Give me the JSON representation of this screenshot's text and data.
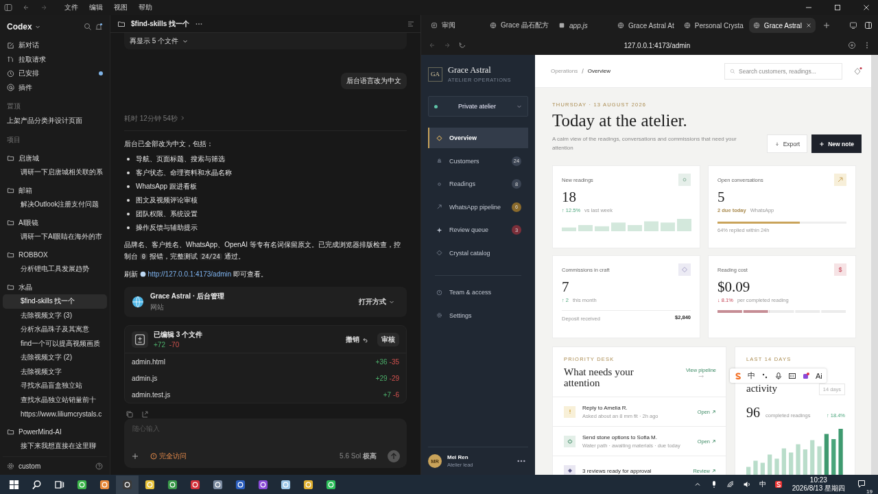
{
  "menu_bar": {
    "items": [
      "文件",
      "编辑",
      "视图",
      "帮助"
    ]
  },
  "codex": {
    "title": "Codex",
    "actions": [
      {
        "label": "新对话",
        "kind": "compose",
        "unread": false
      },
      {
        "label": "拉取请求",
        "kind": "pull",
        "unread": false
      },
      {
        "label": "已安排",
        "kind": "clock",
        "unread": true
      },
      {
        "label": "插件",
        "kind": "plugin",
        "unread": false
      }
    ],
    "pinned": {
      "label": "置顶",
      "threads": [
        {
          "title": "上架产品分类并设计页面",
          "selected": false
        }
      ]
    },
    "projects": {
      "label": "项目",
      "folders": [
        {
          "name": "启唐城",
          "threads": [
            {
              "title": "调研一下启唐城相关联的系",
              "selected": false
            }
          ]
        },
        {
          "name": "邮箱",
          "threads": [
            {
              "title": "解决Outlook注册支付问题",
              "selected": false
            }
          ]
        },
        {
          "name": "AI眼镜",
          "threads": [
            {
              "title": "调研一下AI眼睛在海外的市",
              "selected": false
            }
          ]
        },
        {
          "name": "ROBBOX",
          "threads": [
            {
              "title": "分析锂电工具发展趋势",
              "selected": false
            }
          ]
        },
        {
          "name": "水晶",
          "threads": [
            {
              "title": "$find-skills 找一个",
              "selected": true
            },
            {
              "title": "去除视频文字 (3)",
              "selected": false
            },
            {
              "title": "分析水晶珠子及其寓意",
              "selected": false
            },
            {
              "title": "find一个可以提高视频画质",
              "selected": false
            },
            {
              "title": "去除视频文字 (2)",
              "selected": false
            },
            {
              "title": "去除视频文字",
              "selected": false
            },
            {
              "title": "寻找水晶盲盒独立站",
              "selected": false
            },
            {
              "title": "查找水晶独立站销量前十",
              "selected": false
            },
            {
              "title": "https://www.liliumcrystals.c",
              "selected": false
            }
          ]
        },
        {
          "name": "PowerMind-AI",
          "threads": [
            {
              "title": "接下来我想直接在这里聊",
              "selected": false
            }
          ]
        }
      ]
    },
    "footer": {
      "label": "custom"
    }
  },
  "chat": {
    "title": "$find-skills 找一个",
    "more_files": "再显示 5 个文件",
    "user_message": "后台语言改为中文",
    "duration": "耗时 12分钟 54秒",
    "intro": "后台已全部改为中文，包括：",
    "bullets": [
      "导航、页面标题、搜索与筛选",
      "客户状态、命理资料和水晶名称",
      "WhatsApp 跟进看板",
      "图文及视频评论审核",
      "团队权限、系统设置",
      "操作反馈与辅助提示"
    ],
    "summary": [
      {
        "kind": "text",
        "text": "品牌名、客户姓名、WhatsApp、OpenAI 等专有名词保留原文。已完成浏览器排版检查，控制台 "
      },
      {
        "kind": "code",
        "text": "0"
      },
      {
        "kind": "text",
        "text": " 报错，完整测试 "
      },
      {
        "kind": "code",
        "text": "24/24"
      },
      {
        "kind": "text",
        "text": " 通过。"
      }
    ],
    "refresh": {
      "before": "刷新",
      "link": "http://127.0.0.1:4173/admin",
      "after": "即可查看。"
    },
    "site_card": {
      "title": "Grace Astral · 后台管理",
      "subtitle": "网站",
      "action": "打开方式"
    },
    "changes": {
      "title": "已编辑 3 个文件",
      "added": "+72",
      "removed": "-70",
      "undo": "撤销",
      "review": "审核",
      "files": [
        {
          "name": "admin.html",
          "added": "+36",
          "removed": "-35"
        },
        {
          "name": "admin.js",
          "added": "+29",
          "removed": "-29"
        },
        {
          "name": "admin.test.js",
          "added": "+7",
          "removed": "-6"
        }
      ]
    },
    "composer": {
      "placeholder": "随心输入",
      "access": "完全访问",
      "model": "5.6 Sol",
      "effort": "极高"
    }
  },
  "browser": {
    "tabs": [
      {
        "title": "审阅",
        "kind": "doc",
        "selected": false
      },
      {
        "title": "Grace 晶石配方",
        "kind": "web",
        "selected": false
      },
      {
        "title": "app.js",
        "kind": "file",
        "selected": false
      },
      {
        "title": "Grace Astral At",
        "kind": "web",
        "selected": false
      },
      {
        "title": "Personal Crysta",
        "kind": "web",
        "selected": false
      },
      {
        "title": "Grace Astral",
        "kind": "web",
        "selected": true
      }
    ],
    "url": "127.0.0.1:4173/admin"
  },
  "admin": {
    "brand": {
      "monogram": "GA",
      "name": "Grace Astral",
      "tagline": "ATELIER OPERATIONS"
    },
    "workspace": "Private atelier",
    "nav": [
      {
        "label": "Overview",
        "kind": "overview",
        "selected": true
      },
      {
        "label": "Customers",
        "kind": "customers",
        "badge": "24",
        "color": "#3b4453",
        "selected": false
      },
      {
        "label": "Readings",
        "kind": "readings",
        "badge": "8",
        "color": "#3b4453",
        "selected": false
      },
      {
        "label": "WhatsApp pipeline",
        "kind": "pipeline",
        "badge": "6",
        "color": "#8a6a2c",
        "selected": false
      },
      {
        "label": "Review queue",
        "kind": "review",
        "badge": "3",
        "color": "#7c2f3a",
        "selected": false
      },
      {
        "label": "Crystal catalog",
        "kind": "catalog",
        "selected": false
      }
    ],
    "secondary_nav": [
      {
        "label": "Team & access",
        "kind": "team",
        "selected": false
      },
      {
        "label": "Settings",
        "kind": "settings",
        "selected": false
      }
    ],
    "user": {
      "initials": "MR",
      "name": "Mei Ren",
      "role": "Atelier lead"
    },
    "breadcrumb": [
      "Operations",
      "Overview"
    ],
    "breadcrumb_separator": "/",
    "search": {
      "placeholder": "Search customers, readings..."
    },
    "has_unread": true,
    "date": "THURSDAY · 13 AUGUST 2026",
    "heading": "Today at the atelier.",
    "subheading": "A calm view of the readings, conversations and commissions that need your attention",
    "actions": [
      {
        "label": "Export",
        "kind": "secondary"
      },
      {
        "label": "New note",
        "kind": "primary"
      }
    ],
    "stats": [
      {
        "kind": "sparkline",
        "title": "New readings",
        "value": "18",
        "delta": "↑ 12.5%",
        "note": "vs last week",
        "color": "#e6efea"
      },
      {
        "kind": "progress",
        "title": "Open conversations",
        "value": "5",
        "delta": "2 due today",
        "note": "WhatsApp",
        "level": 0.64,
        "caption": "64% replied within 24h",
        "color": "#f7efd9"
      },
      {
        "kind": "footer",
        "title": "Commissions in craft",
        "value": "7",
        "delta": "↑ 2",
        "note": "this month",
        "footer_label": "Deposit received",
        "footer_value": "$2,840",
        "color": "#ecebf4"
      },
      {
        "kind": "segments",
        "title": "Reading cost",
        "value": "$0.09",
        "delta": "↓ 8.1%",
        "note": "per completed reading",
        "level": 0.4,
        "symbol": "$",
        "color": "#f6e3e5"
      }
    ],
    "priority": {
      "eyebrow": "PRIORITY DESK",
      "title": "What needs your attention",
      "link": "View pipeline",
      "items": [
        {
          "kind": "alert",
          "title": "Reply to Amelia R.",
          "meta": "Asked about an 8 mm fit · 2h ago",
          "action": "Open",
          "color": "#f8f0d8"
        },
        {
          "kind": "power",
          "title": "Send stone options to Sofia M.",
          "meta": "Water path · awaiting materials · due today",
          "action": "Open",
          "color": "#e3efe8"
        },
        {
          "kind": "review",
          "title": "3 reviews ready for approval",
          "action": "Review",
          "color": "#e9e7f2"
        }
      ]
    },
    "activity": {
      "eyebrow": "LAST 14 DAYS",
      "title": "activity",
      "range": "14 days",
      "value": "96",
      "label": "completed readings",
      "delta": "↑ 18.4%"
    }
  },
  "ime_toolbar": {
    "items": [
      "中",
      "Ai"
    ]
  },
  "taskbar": {
    "language": "中",
    "time": "10:23",
    "date": "2026/8/13 星期四",
    "notifications": "19"
  }
}
